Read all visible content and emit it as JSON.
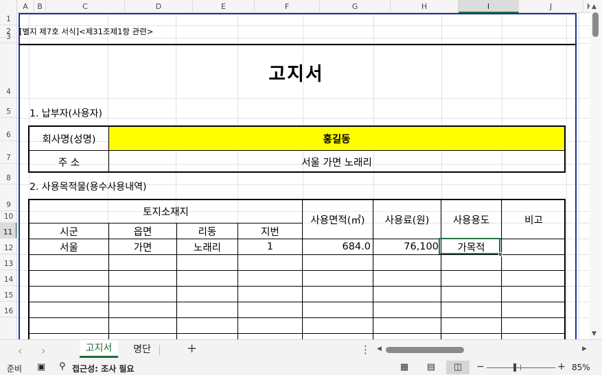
{
  "columns": [
    {
      "letter": "A",
      "selected": false
    },
    {
      "letter": "B",
      "selected": false
    },
    {
      "letter": "C",
      "selected": false
    },
    {
      "letter": "D",
      "selected": false
    },
    {
      "letter": "E",
      "selected": false
    },
    {
      "letter": "F",
      "selected": false
    },
    {
      "letter": "G",
      "selected": false
    },
    {
      "letter": "H",
      "selected": false
    },
    {
      "letter": "I",
      "selected": true
    },
    {
      "letter": "J",
      "selected": false
    },
    {
      "letter": "K",
      "selected": false
    }
  ],
  "rows": [
    {
      "num": "1",
      "selected": false
    },
    {
      "num": "2",
      "selected": false
    },
    {
      "num": "3",
      "selected": false
    },
    {
      "num": "4",
      "selected": false
    },
    {
      "num": "5",
      "selected": false
    },
    {
      "num": "6",
      "selected": false
    },
    {
      "num": "7",
      "selected": false
    },
    {
      "num": "8",
      "selected": false
    },
    {
      "num": "9",
      "selected": false
    },
    {
      "num": "10",
      "selected": false
    },
    {
      "num": "11",
      "selected": true
    },
    {
      "num": "12",
      "selected": false
    },
    {
      "num": "13",
      "selected": false
    },
    {
      "num": "14",
      "selected": false
    },
    {
      "num": "15",
      "selected": false
    },
    {
      "num": "16",
      "selected": false
    }
  ],
  "sheet": {
    "form_ref": "[별지 제7호 서식]<제31조제1항 관련>",
    "title": "고지서",
    "section1": "1. 납부자(사용자)",
    "payer": {
      "name_label": "회사명(성명)",
      "name_value": "홍길동",
      "address_label": "주 소",
      "address_value": "서울 가면 노래리"
    },
    "section2": "2. 사용목적물(용수사용내역)",
    "usage": {
      "land_header": "토지소재지",
      "sigun": "시군",
      "eupmyeon": "읍면",
      "ridong": "리동",
      "jibeon": "지번",
      "area": "사용면적(㎡)",
      "fee": "사용료(원)",
      "purpose": "사용용도",
      "remarks": "비고",
      "row1": {
        "sigun": "서울",
        "eupmyeon": "가면",
        "ridong": "노래리",
        "jibeon": "1",
        "area": "684.0",
        "fee": "76,100",
        "purpose": "가목적",
        "remarks": ""
      }
    }
  },
  "tabs": {
    "active": "고지서",
    "second": "명단",
    "add": "+",
    "more": "⋮"
  },
  "status": {
    "ready": "준비",
    "accessibility": "접근성: 조사 필요",
    "zoom": "85%"
  },
  "icons": {
    "accent": "#217346",
    "print_area_border": "#1f2ea0",
    "highlight_fill": "#ffff00"
  }
}
